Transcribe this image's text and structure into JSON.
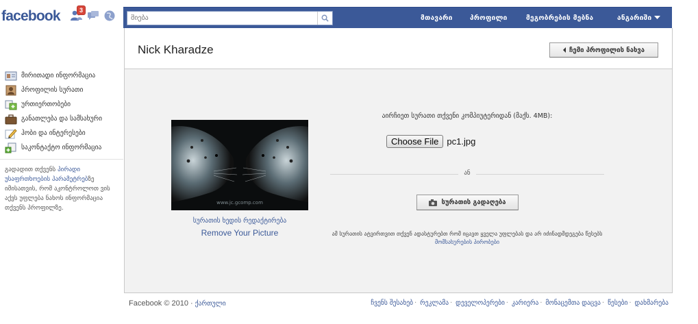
{
  "header": {
    "logo": "facebook",
    "notifications_count": "3",
    "search": {
      "value": "მიება",
      "placeholder": ""
    },
    "nav": [
      {
        "id": "home",
        "label": "მთავარი"
      },
      {
        "id": "profile",
        "label": "პროფილი"
      },
      {
        "id": "find-friends",
        "label": "მეგობრების მებნა"
      },
      {
        "id": "account",
        "label": "ანგარიში"
      }
    ],
    "colors": {
      "brand": "#3b5998",
      "badge": "#d8473a"
    }
  },
  "sidebar": {
    "items": [
      {
        "id": "basic-info",
        "label": "მირითადი ინფორმაცია",
        "icon": "id-card-icon"
      },
      {
        "id": "profile-picture",
        "label": "პროფილის სურათი",
        "icon": "portrait-icon"
      },
      {
        "id": "relationships",
        "label": "ურთიერთობები",
        "icon": "relationship-icon"
      },
      {
        "id": "education-work",
        "label": "განათლება და სამსახური",
        "icon": "briefcase-icon"
      },
      {
        "id": "likes-interests",
        "label": "ჰობი და ინტერესები",
        "icon": "pencil-icon"
      },
      {
        "id": "contact-info",
        "label": "საკონტაქტო ინფორმაცია",
        "icon": "contact-icon"
      }
    ],
    "note_prefix": "გადადით თქვენს ",
    "note_link": "პირადი უსაფრთხოების პარამეტრებ",
    "note_suffix": "ზე იმისათვის, რომ აკონტროლოთ ვის აქვს უფლება ნახოს ინფორმაცია თქვენს პროფილზე."
  },
  "main": {
    "title": "Nick Kharadze",
    "view_profile_label": "ჩემი პროფილის ნახვა",
    "photo_watermark": "www.jc.gcomp.com",
    "edit_thumbnail_label": "სურათის ხედის რედაქტირება",
    "remove_picture_label": "Remove Your Picture",
    "upload_instruction": "აირჩიეთ სურათი თქვენი კომპიუტერიდან (მაქს. 4MB):",
    "choose_file_label": "Choose File",
    "file_name": "pc1.jpg",
    "or_label": "ან",
    "take_photo_label": "სურათის გადაღება",
    "notice_text": "ამ სურათის ატვირთვით თქვენ ადასტურებთ რომ იცავთ ყველა უფლებას და არ იძინადმდეგება წესებს ",
    "notice_link": "მომსახურების პირობები"
  },
  "footer": {
    "copyright": "Facebook © 2010 · ",
    "language": "ქართული",
    "links": [
      "ჩვენს შესახებ",
      "რეკლამა",
      "დეველოპერები",
      "კარიერა",
      "მონაცემთა დაცვა",
      "წესები",
      "დახმარება"
    ]
  }
}
